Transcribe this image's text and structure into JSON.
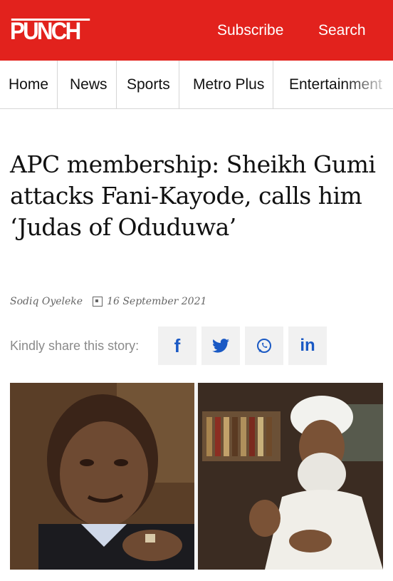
{
  "header": {
    "logo": "PUNCH",
    "subscribe_label": "Subscribe",
    "search_label": "Search",
    "brand_color": "#e2221d"
  },
  "nav": {
    "items": [
      {
        "label": "Home"
      },
      {
        "label": "News"
      },
      {
        "label": "Sports"
      },
      {
        "label": "Metro Plus"
      },
      {
        "label": "Entertainment"
      }
    ]
  },
  "article": {
    "title": "APC membership: Sheikh Gumi attacks Fani-Kayode, calls him ‘Judas of Oduduwa’",
    "author": "Sodiq Oyeleke",
    "date": "16 September 2021",
    "date_icon": "calendar-icon"
  },
  "share": {
    "label": "Kindly share this story:",
    "buttons": [
      {
        "name": "facebook",
        "icon": "facebook-icon"
      },
      {
        "name": "twitter",
        "icon": "twitter-icon"
      },
      {
        "name": "whatsapp",
        "icon": "whatsapp-icon"
      },
      {
        "name": "linkedin",
        "icon": "linkedin-icon"
      }
    ],
    "icon_color": "#1a59c4"
  },
  "image": {
    "panels": [
      "left-portrait",
      "right-portrait"
    ]
  }
}
